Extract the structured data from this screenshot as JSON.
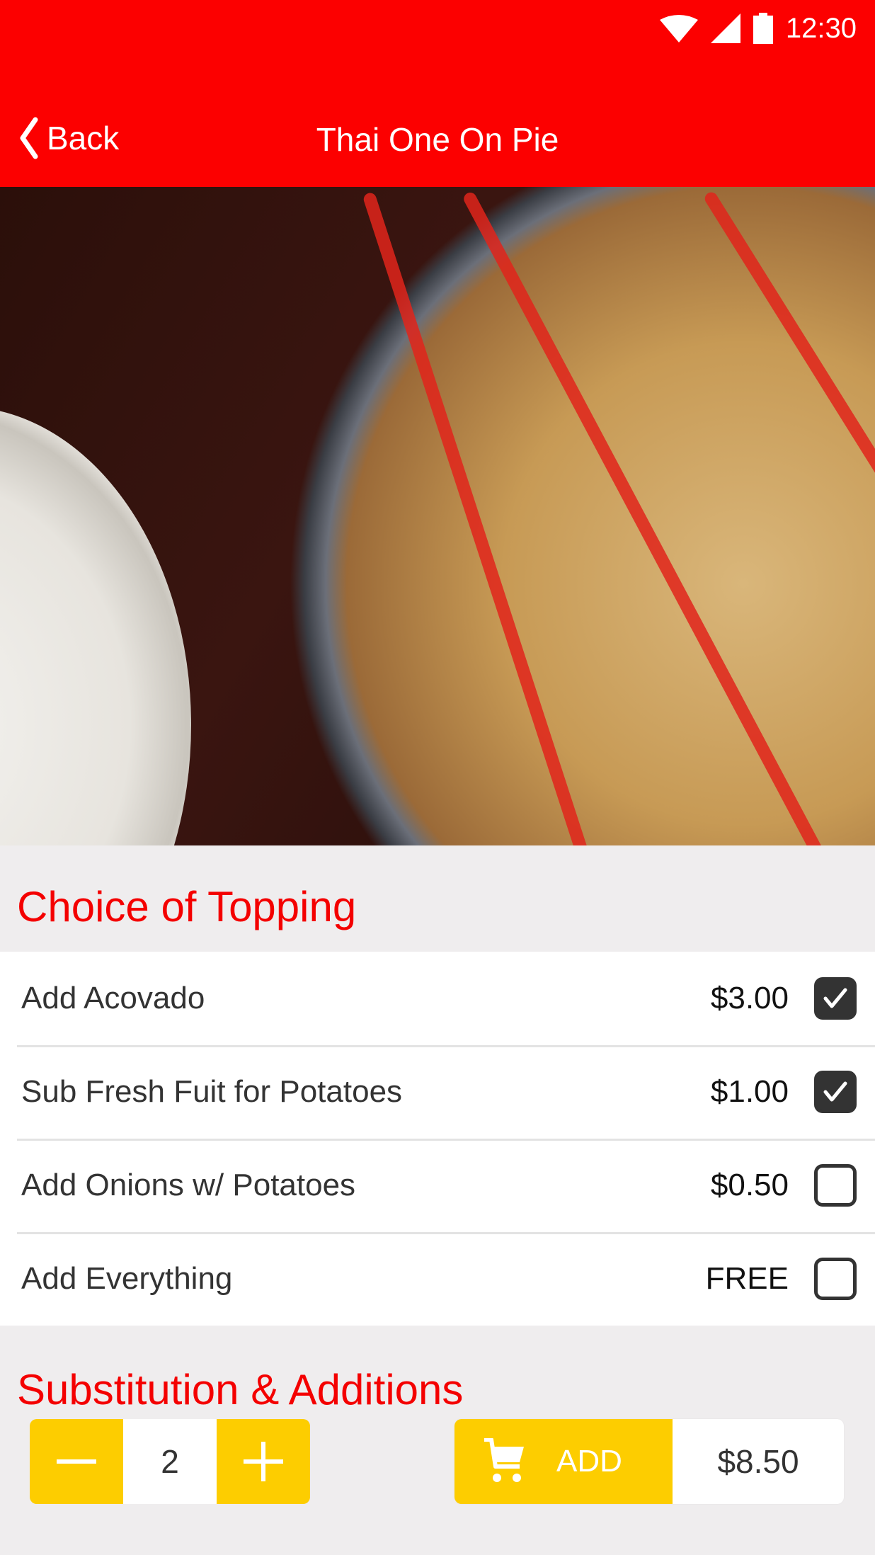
{
  "status_bar": {
    "time": "12:30",
    "icons": [
      "wifi-icon",
      "cellular-signal-icon",
      "battery-icon"
    ]
  },
  "nav": {
    "back_label": "Back",
    "title": "Thai One On Pie"
  },
  "colors": {
    "brand_red": "#fc0000",
    "accent_yellow": "#fdcd00",
    "section_title_red": "#f40000"
  },
  "hero_image": {
    "description": "Pizza with peppers, onions and sriracha drizzle on a metal tray next to a white plate"
  },
  "sections": [
    {
      "title": "Choice of Topping",
      "options": [
        {
          "label": "Add Acovado",
          "price": "$3.00",
          "checked": true
        },
        {
          "label": "Sub Fresh Fuit for Potatoes",
          "price": "$1.00",
          "checked": true
        },
        {
          "label": "Add Onions w/ Potatoes",
          "price": "$0.50",
          "checked": false
        },
        {
          "label": "Add Everything",
          "price": "FREE",
          "checked": false
        }
      ]
    },
    {
      "title": "Substitution & Additions"
    }
  ],
  "footer": {
    "quantity": "2",
    "add_label": "ADD",
    "total_price": "$8.50"
  }
}
